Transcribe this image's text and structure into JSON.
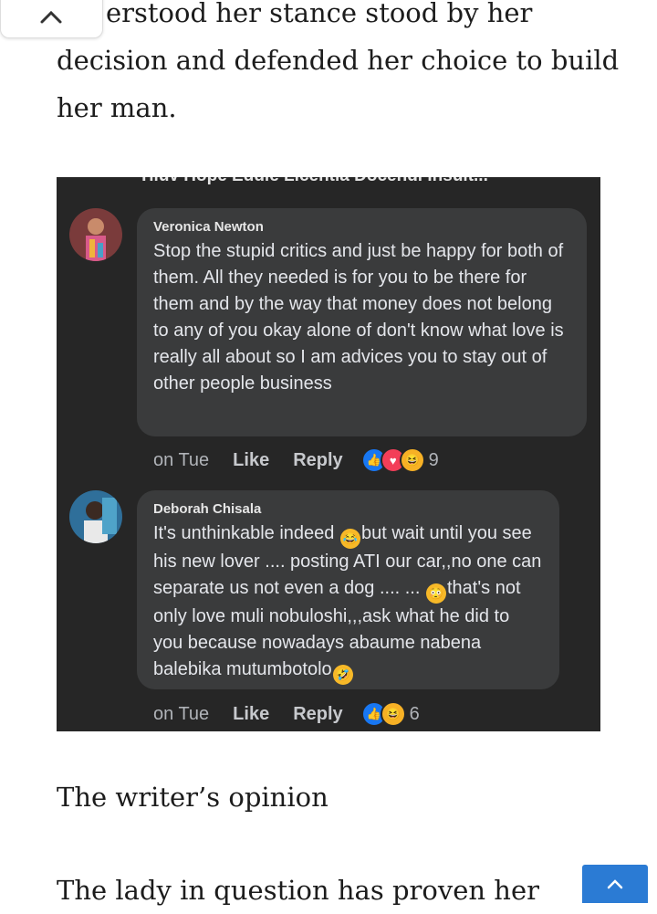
{
  "article": {
    "line1": "erstood her stance stood by her",
    "line2": "decision and defended her choice to build",
    "line3": "her man.",
    "section_heading": "The writer’s opinion",
    "bottom_line": "The lady in question has proven her"
  },
  "screenshot": {
    "top_cut_text": "Tiluv Hope  Eddie Licentia Docendi Insult...",
    "comments": [
      {
        "author": "Veronica Newton",
        "text": "Stop the stupid critics and just be happy for both of them. All they needed is for you to be there for them and by the way that money does not belong to any of you okay alone of don't know what love is really all about so I am advices you to stay out of other people business",
        "time": "on Tue",
        "like_label": "Like",
        "reply_label": "Reply",
        "reaction_count": "9",
        "reactions": [
          "like",
          "love",
          "haha"
        ]
      },
      {
        "author": "Deborah Chisala",
        "text_parts": [
          "It's unthinkable indeed ",
          "but wait until you see his new lover .... posting ATI our car,,no one can separate us not even a dog .... ... ",
          "that's not only love muli nobuloshi,,,ask what he did to you because nowadays abaume nabena balebika mutumbotolo"
        ],
        "time": "on Tue",
        "like_label": "Like",
        "reply_label": "Reply",
        "reaction_count": "6",
        "reactions": [
          "like",
          "haha"
        ]
      }
    ]
  },
  "colors": {
    "screenshot_bg": "#262626",
    "bubble_bg": "#3a3b3c",
    "scroll_top_button": "#2b7bd4"
  }
}
